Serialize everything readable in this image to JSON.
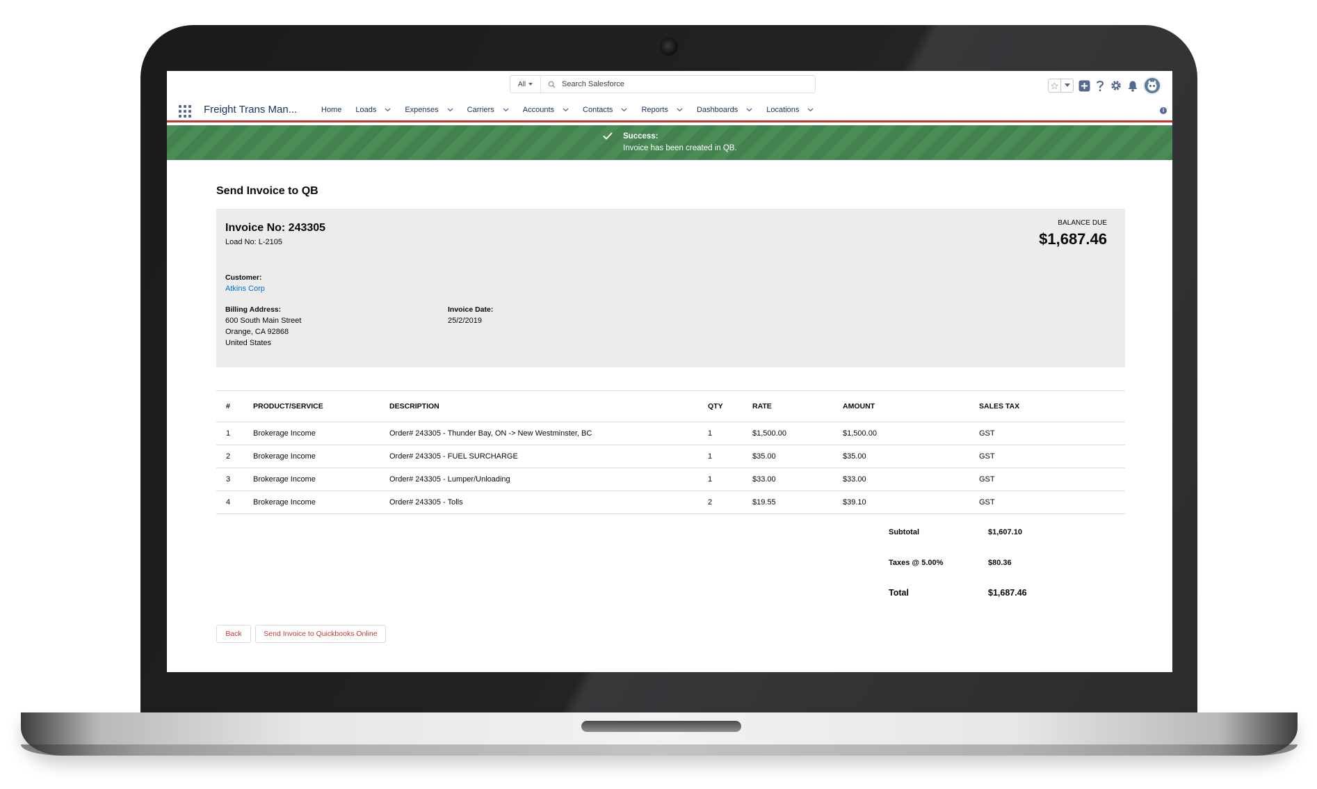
{
  "colors": {
    "brand_red": "#c23934",
    "success_green": "#4a8b56",
    "link_blue": "#0070d2",
    "card_gray": "#ececec"
  },
  "header": {
    "search": {
      "scope": "All",
      "placeholder": "Search Salesforce"
    },
    "icons": [
      "favorites-star-icon",
      "favorites-dropdown-icon",
      "global-actions-icon",
      "help-icon",
      "setup-gear-icon",
      "notifications-bell-icon",
      "user-avatar"
    ]
  },
  "nav": {
    "app_name": "Freight Trans Man...",
    "items": [
      {
        "label": "Home",
        "has_menu": false
      },
      {
        "label": "Loads",
        "has_menu": true
      },
      {
        "label": "Expenses",
        "has_menu": true
      },
      {
        "label": "Carriers",
        "has_menu": true
      },
      {
        "label": "Accounts",
        "has_menu": true
      },
      {
        "label": "Contacts",
        "has_menu": true
      },
      {
        "label": "Reports",
        "has_menu": true
      },
      {
        "label": "Dashboards",
        "has_menu": true
      },
      {
        "label": "Locations",
        "has_menu": true
      }
    ]
  },
  "toast": {
    "title": "Success:",
    "message": "Invoice has been created in QB."
  },
  "page": {
    "title": "Send Invoice to QB"
  },
  "invoice": {
    "number_label": "Invoice No: 243305",
    "load_label": "Load No: L-2105",
    "balance_due_label": "BALANCE DUE",
    "balance_due_value": "$1,687.46",
    "customer_label": "Customer:",
    "customer_name": "Atkins Corp",
    "billing_address_label": "Billing Address:",
    "billing_address": [
      "600 South Main Street",
      "Orange, CA 92868",
      "United States"
    ],
    "invoice_date_label": "Invoice Date:",
    "invoice_date": "25/2/2019"
  },
  "line_items": {
    "columns": [
      "#",
      "PRODUCT/SERVICE",
      "DESCRIPTION",
      "QTY",
      "RATE",
      "AMOUNT",
      "SALES TAX"
    ],
    "rows": [
      [
        "1",
        "Brokerage Income",
        "Order# 243305 - Thunder Bay, ON -> New Westminster, BC",
        "1",
        "$1,500.00",
        "$1,500.00",
        "GST"
      ],
      [
        "2",
        "Brokerage Income",
        "Order# 243305 - FUEL SURCHARGE",
        "1",
        "$35.00",
        "$35.00",
        "GST"
      ],
      [
        "3",
        "Brokerage Income",
        "Order# 243305 - Lumper/Unloading",
        "1",
        "$33.00",
        "$33.00",
        "GST"
      ],
      [
        "4",
        "Brokerage Income",
        "Order# 243305 - Tolls",
        "2",
        "$19.55",
        "$39.10",
        "GST"
      ]
    ]
  },
  "totals": {
    "subtotal_label": "Subtotal",
    "subtotal_value": "$1,607.10",
    "taxes_label": "Taxes @ 5.00%",
    "taxes_value": "$80.36",
    "total_label": "Total",
    "total_value": "$1,687.46"
  },
  "actions": {
    "back_label": "Back",
    "send_label": "Send Invoice to Quickbooks Online"
  }
}
